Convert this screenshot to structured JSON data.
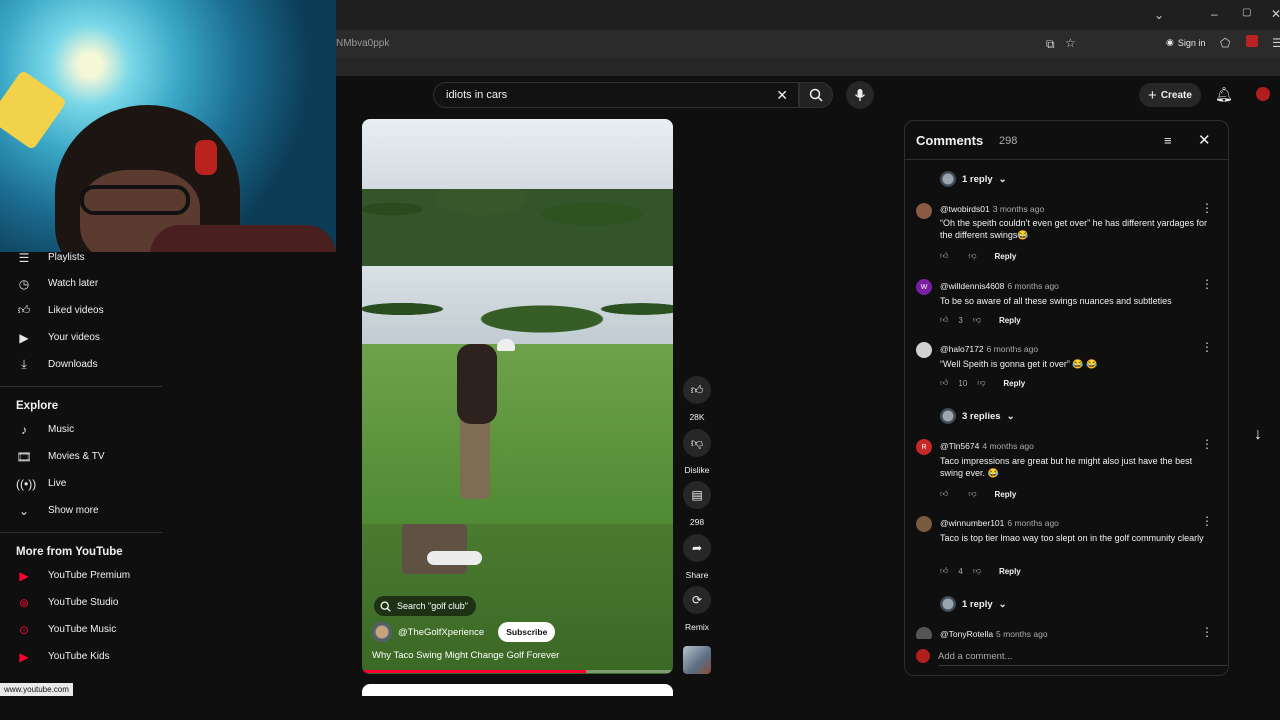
{
  "browser": {
    "url_fragment": "NMbva0ppk",
    "sign_in": "Sign in",
    "status_url": "www.youtube.com"
  },
  "header": {
    "search_value": "idiots in cars",
    "create_label": "Create"
  },
  "sidebar": {
    "you_items": [
      {
        "label": "Playlists",
        "icon": "playlists-icon"
      },
      {
        "label": "Watch later",
        "icon": "clock-icon"
      },
      {
        "label": "Liked videos",
        "icon": "thumbs-up-icon"
      },
      {
        "label": "Your videos",
        "icon": "video-icon"
      },
      {
        "label": "Downloads",
        "icon": "download-icon"
      }
    ],
    "explore_heading": "Explore",
    "explore_items": [
      {
        "label": "Music",
        "icon": "music-note-icon"
      },
      {
        "label": "Movies & TV",
        "icon": "film-icon"
      },
      {
        "label": "Live",
        "icon": "live-icon"
      },
      {
        "label": "Show more",
        "icon": "chevron-down-icon"
      }
    ],
    "more_heading": "More from YouTube",
    "more_items": [
      {
        "label": "YouTube Premium"
      },
      {
        "label": "YouTube Studio"
      },
      {
        "label": "YouTube Music"
      },
      {
        "label": "YouTube Kids"
      }
    ]
  },
  "short": {
    "search_chip": "Search \"golf club\"",
    "channel": "@TheGolfXperience",
    "subscribe": "Subscribe",
    "title": "Why Taco Swing Might Change Golf Forever",
    "progress": 0.72,
    "actions": [
      {
        "label": "28K",
        "icon": "thumbs-up-icon"
      },
      {
        "label": "Dislike",
        "icon": "thumbs-down-icon"
      },
      {
        "label": "298",
        "icon": "comment-icon"
      },
      {
        "label": "Share",
        "icon": "share-icon"
      },
      {
        "label": "Remix",
        "icon": "remix-icon"
      }
    ]
  },
  "comments": {
    "title": "Comments",
    "count": "298",
    "top_replies": "1 reply",
    "items": [
      {
        "user": "@twobirds01",
        "time": "3 months ago",
        "text": "“Oh the speith couldn’t even get over” he has different yardages for the different swings😂",
        "likes": "",
        "reply": "Reply",
        "avatar_letter": "",
        "avatar_color": "#8a5a44"
      },
      {
        "user": "@willdennis4608",
        "time": "6 months ago",
        "text": "To be so aware of all these swings nuances and subtleties",
        "likes": "3",
        "reply": "Reply",
        "avatar_letter": "W",
        "avatar_color": "#7b1fa2"
      },
      {
        "user": "@halo7172",
        "time": "6 months ago",
        "text": "“Well Speith is gonna get it over” 😂 😂",
        "likes": "10",
        "reply": "Reply",
        "avatar_letter": "",
        "avatar_color": "#cfcfcf"
      },
      {
        "user": "@Tln5674",
        "time": "4 months ago",
        "text": "Taco impressions are great but he might also just have the best swing ever. 😂",
        "likes": "",
        "reply": "Reply",
        "avatar_letter": "R",
        "avatar_color": "#c62828"
      },
      {
        "user": "@winnumber101",
        "time": "6 months ago",
        "text": "Taco is top tier lmao way too slept on in the golf community clearly",
        "likes": "4",
        "reply": "Reply",
        "avatar_letter": "",
        "avatar_color": "#7a5a3e"
      },
      {
        "user": "@TonyRotella",
        "time": "5 months ago",
        "text": "",
        "likes": "",
        "reply": "",
        "avatar_letter": "",
        "avatar_color": "#555555"
      }
    ],
    "replies_after": [
      "3 replies",
      "1 reply"
    ],
    "add_placeholder": "Add a comment..."
  }
}
